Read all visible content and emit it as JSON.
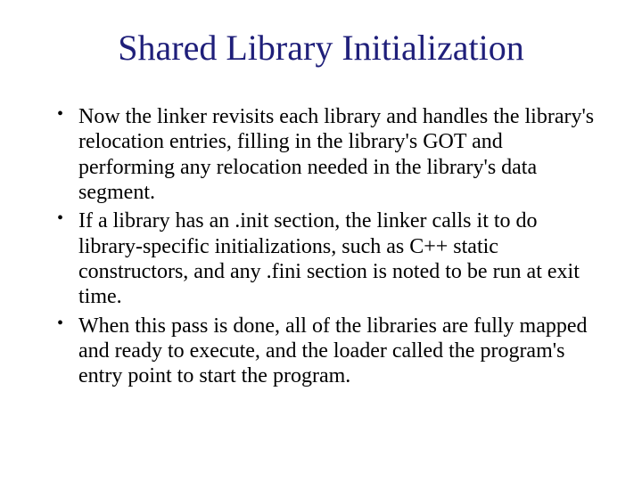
{
  "title": "Shared Library Initialization",
  "bullets": [
    "Now the linker revisits each library and handles the library's relocation entries, filling in the library's GOT and performing any relocation needed in the library's data segment.",
    "If a library has an .init section, the linker calls it to do library-specific initializations, such as C++ static constructors, and any .fini section is noted to be run at exit time.",
    "When this pass is done, all of the libraries are fully mapped and ready to execute, and the loader called the program's entry point to start the program."
  ]
}
